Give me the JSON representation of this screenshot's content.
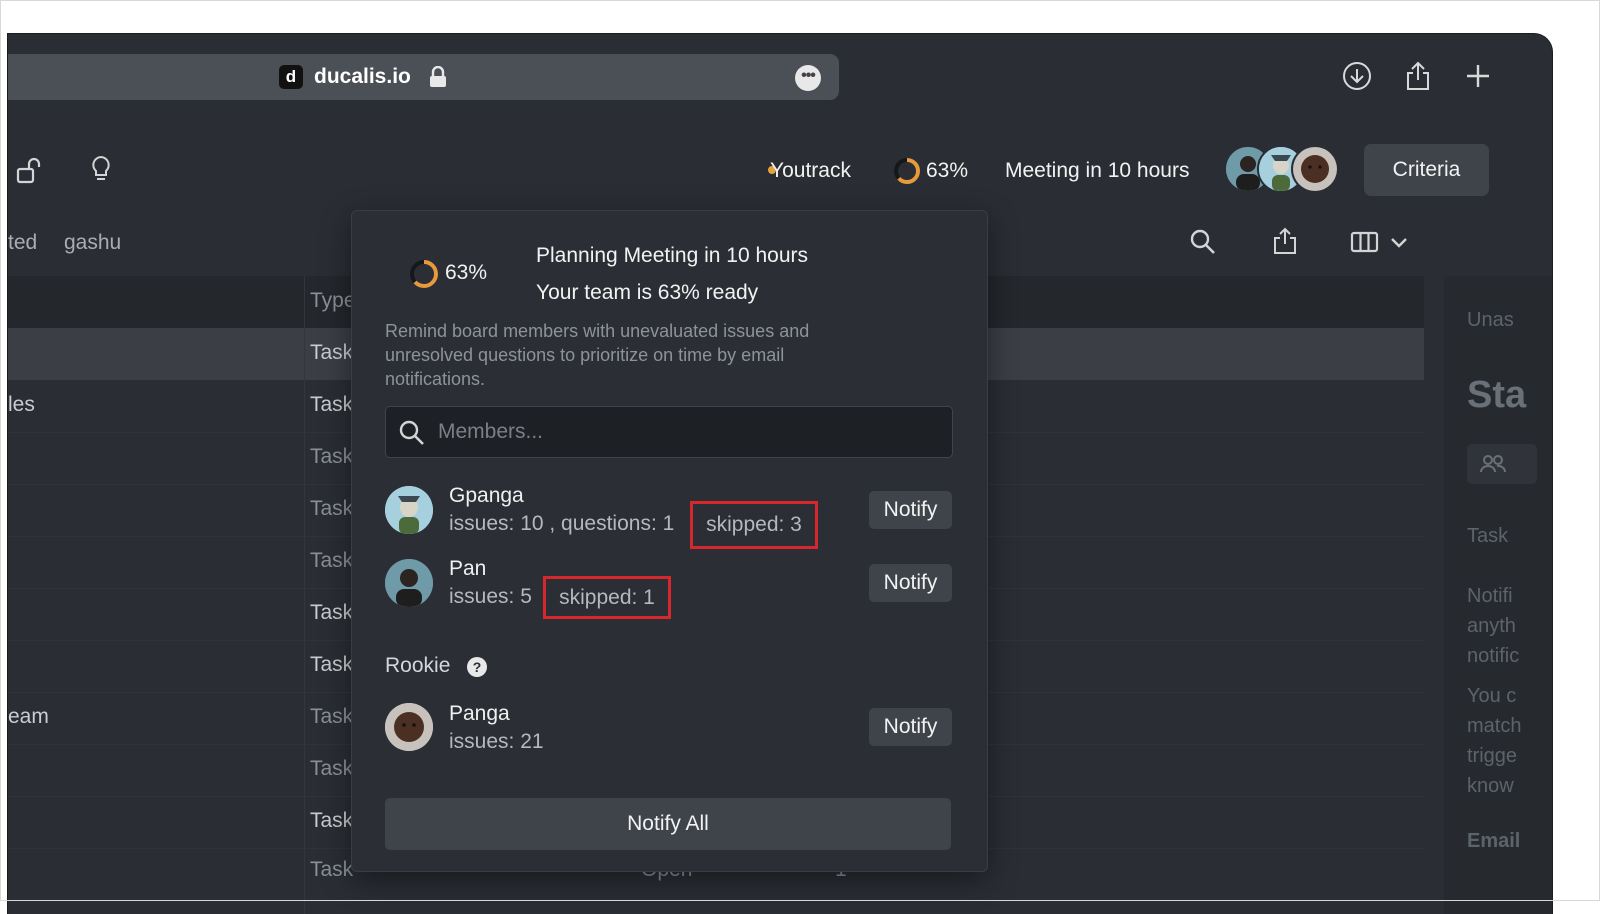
{
  "browser": {
    "favicon_letter": "d",
    "url": "ducalis.io",
    "icons": [
      "lock-icon",
      "more-icon",
      "download-icon",
      "share-icon",
      "new-tab-icon"
    ]
  },
  "header": {
    "integration": "Youtrack",
    "readiness": "63%",
    "readiness_fraction": 0.63,
    "meeting": "Meeting in 10 hours",
    "criteria_label": "Criteria",
    "accent_color": "#e6a23c"
  },
  "toolbar": {
    "tab_partial": "ted",
    "tab_user": "gashu",
    "icons": [
      "search-icon",
      "export-icon",
      "columns-icon",
      "chevron-down-icon"
    ]
  },
  "table": {
    "type_header": "Type",
    "left_cells": [
      "les",
      "eam"
    ],
    "type_cells": [
      "Task",
      "Task",
      "Task",
      "Task",
      "Task",
      "Task",
      "Task",
      "Task",
      "Task",
      "Task",
      "Task"
    ],
    "bottom_row": {
      "dash": "-",
      "status": "Open",
      "count": "1"
    }
  },
  "right_panel": {
    "unassigned": "Unas",
    "heading": "Sta",
    "task": "Task",
    "text_lines": [
      "Notifi",
      "anyth",
      "notific",
      "You c",
      "match",
      "trigge",
      "know"
    ],
    "email": "Email"
  },
  "popup": {
    "readiness": "63%",
    "title_line1": "Planning Meeting in 10 hours",
    "title_line2": "Your team is 63% ready",
    "description": "Remind board members with unevaluated issues and unresolved questions to prioritize on time by email notifications.",
    "search_placeholder": "Members...",
    "members": [
      {
        "name": "Gpanga",
        "meta": "issues: 10 , questions: 1",
        "skipped": "skipped: 3",
        "notify": "Notify"
      },
      {
        "name": "Pan",
        "meta": "issues: 5",
        "skipped": "skipped: 1",
        "notify": "Notify"
      }
    ],
    "rookie_label": "Rookie",
    "rookie_help": "?",
    "rookies": [
      {
        "name": "Panga",
        "meta": "issues: 21",
        "notify": "Notify"
      }
    ],
    "notify_all": "Notify All"
  }
}
